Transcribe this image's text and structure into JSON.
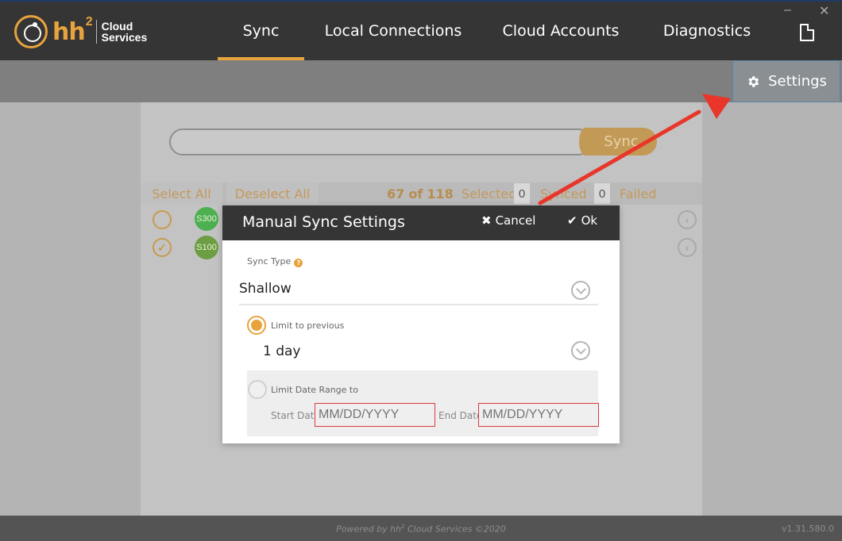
{
  "app": {
    "logo_brand": "hh",
    "logo_superscript": "2",
    "logo_line1": "Cloud",
    "logo_line2": "Services",
    "minimize_glyph": "–",
    "close_glyph": "✕"
  },
  "nav": {
    "tabs": [
      {
        "label": "Sync",
        "active": true
      },
      {
        "label": "Local Connections",
        "active": false
      },
      {
        "label": "Cloud Accounts",
        "active": false
      },
      {
        "label": "Diagnostics",
        "active": false
      }
    ],
    "document_icon": "document-icon"
  },
  "toolbar": {
    "settings_label": "Settings",
    "settings_icon": "gear-icon"
  },
  "sync": {
    "search_value": "",
    "sync_button_label": "Sync",
    "select_all_label": "Select All",
    "deselect_all_label": "Deselect All",
    "selected_count": "67",
    "of_label": "of",
    "total_count": "118",
    "selected_label": "Selected",
    "synced_count": "0",
    "synced_label": "Synced",
    "failed_count": "0",
    "failed_label": "Failed",
    "rows": [
      {
        "badge": "S300",
        "checked": false,
        "badge_color": "#4caf50"
      },
      {
        "badge": "S100",
        "checked": true,
        "badge_color": "#6d9e43"
      }
    ]
  },
  "dialog": {
    "title": "Manual Sync Settings",
    "cancel_label": "Cancel",
    "ok_label": "Ok",
    "sync_type_label": "Sync Type",
    "help_glyph": "?",
    "sync_type_value": "Shallow",
    "limit_previous_label": "Limit to previous",
    "limit_previous_value": "1 day",
    "limit_previous_selected": true,
    "limit_range_label": "Limit Date Range to",
    "start_date_label": "Start Date",
    "start_date_placeholder": "MM/DD/YYYY",
    "end_date_label": "End Date",
    "end_date_placeholder": "MM/DD/YYYY"
  },
  "footer": {
    "powered_prefix": "Powered by hh",
    "powered_sup": "2",
    "powered_suffix": " Cloud Services ©2020",
    "version": "v1.31.580.0"
  },
  "colors": {
    "accent": "#e8a33d",
    "nav_bg": "#353535",
    "annotation_arrow": "#e8362a",
    "error_border": "#d93a3a"
  }
}
